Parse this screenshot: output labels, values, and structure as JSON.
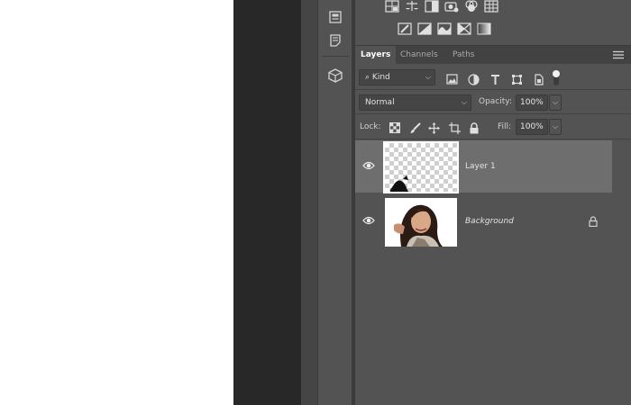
{
  "app": {
    "accent_color": "#6e6e6e",
    "panel_bg": "#535353"
  },
  "adjustments": {
    "row1_icons": [
      "brightness-contrast-icon",
      "levels-icon",
      "curves-icon",
      "exposure-icon",
      "vibrance-icon",
      "color-balance-grid-icon"
    ],
    "row2_icons": [
      "posterize-icon",
      "threshold-icon",
      "gradient-map-icon",
      "selective-color-icon",
      "gradient-icon"
    ]
  },
  "tabs": [
    {
      "label": "Layers",
      "active": true
    },
    {
      "label": "Channels",
      "active": false
    },
    {
      "label": "Paths",
      "active": false
    }
  ],
  "filter": {
    "kind_label": "Kind",
    "icons": [
      "pixel-filter-icon",
      "adjustment-filter-icon",
      "type-filter-icon",
      "shape-filter-icon",
      "smart-object-filter-icon",
      "filter-toggle-icon"
    ]
  },
  "blend": {
    "mode": "Normal",
    "opacity_label": "Opacity:",
    "opacity_value": "100%"
  },
  "lock": {
    "label": "Lock:",
    "fill_label": "Fill:",
    "fill_value": "100%"
  },
  "layers": [
    {
      "name": "Layer 1",
      "selected": true,
      "visible": true,
      "locked": false,
      "italic": false,
      "transparent": true
    },
    {
      "name": "Background",
      "selected": false,
      "visible": true,
      "locked": true,
      "italic": true,
      "transparent": false
    }
  ]
}
